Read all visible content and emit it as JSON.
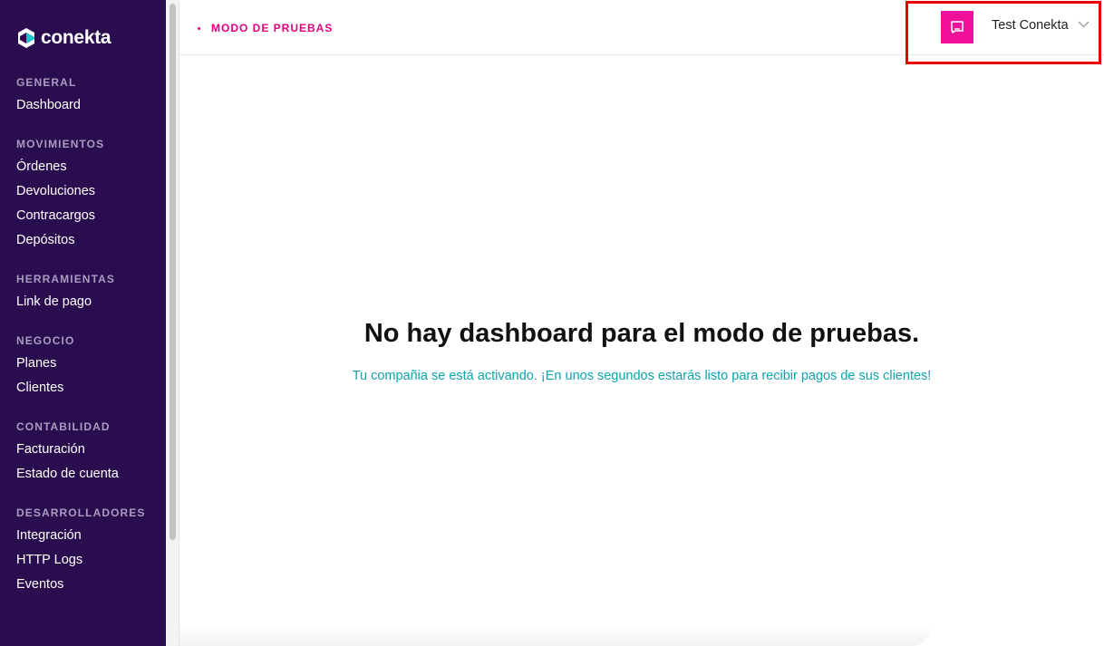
{
  "brand": {
    "name": "conekta"
  },
  "sidebar": {
    "sections": [
      {
        "title": "GENERAL",
        "items": [
          "Dashboard"
        ]
      },
      {
        "title": "MOVIMIENTOS",
        "items": [
          "Órdenes",
          "Devoluciones",
          "Contracargos",
          "Depósitos"
        ]
      },
      {
        "title": "HERRAMIENTAS",
        "items": [
          "Link de pago"
        ]
      },
      {
        "title": "NEGOCIO",
        "items": [
          "Planes",
          "Clientes"
        ]
      },
      {
        "title": "CONTABILIDAD",
        "items": [
          "Facturación",
          "Estado de cuenta"
        ]
      },
      {
        "title": "DESARROLLADORES",
        "items": [
          "Integración",
          "HTTP Logs",
          "Eventos"
        ]
      }
    ]
  },
  "header": {
    "mode_label": "MODO DE PRUEBAS",
    "account_name": "Test Conekta",
    "avatar_icon": "chat-bubble-icon",
    "dropdown_icon": "chevron-down-icon"
  },
  "main": {
    "title": "No hay dashboard para el modo de pruebas.",
    "subtitle": "Tu compañia se está activando. ¡En unos segundos estarás listo para recibir pagos de sus clientes!"
  },
  "colors": {
    "sidebar_bg": "#2a0d4f",
    "accent_pink": "#e6007e",
    "avatar_pink": "#f0109a",
    "teal_text": "#0fa3ad",
    "highlight_red": "#e60000"
  }
}
